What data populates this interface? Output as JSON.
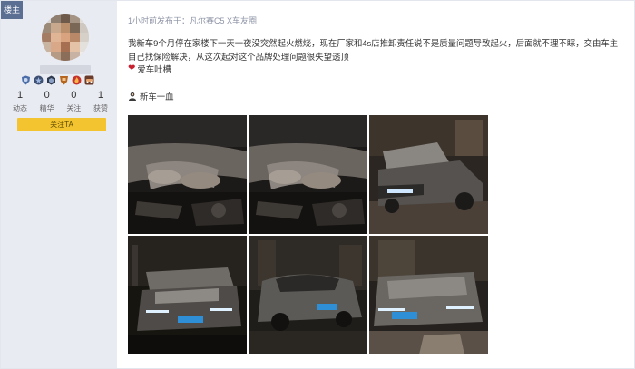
{
  "user": {
    "owner_badge": "楼主",
    "avatar_icon": "blurred-avatar-icon",
    "medals": [
      "shield-medal-icon",
      "star-medal-icon",
      "hex-medal-icon",
      "crest-medal-icon",
      "flame-medal-icon",
      "car-medal-icon"
    ],
    "stats": [
      {
        "value": "1",
        "label": "动态"
      },
      {
        "value": "0",
        "label": "精华"
      },
      {
        "value": "0",
        "label": "关注"
      },
      {
        "value": "1",
        "label": "获赞"
      }
    ],
    "follow_label": "关注TA"
  },
  "post": {
    "meta_prefix": "1小时前发布于：",
    "forum_name": "凡尔赛C5 X车友圈",
    "body": "我新车9个月停在家楼下一天一夜没突然起火燃烧，现在厂家和4s店推卸责任说不是质量问题导致起火，后面就不理不睬，交由车主自己找保险解决，从这次起对这个品牌处理问题很失望透顶",
    "tag_icon": "heart-icon",
    "tag_label": "爱车吐槽",
    "badge_icon": "user-badge-icon",
    "badge_label": "新车一血",
    "photos": [
      {
        "name": "engine-bay-photo-1"
      },
      {
        "name": "engine-bay-photo-2"
      },
      {
        "name": "car-front-hood-open-photo"
      },
      {
        "name": "car-front-plate-photo-1"
      },
      {
        "name": "car-side-night-photo"
      },
      {
        "name": "car-front-plate-photo-2"
      }
    ]
  },
  "colors": {
    "sidebar_bg": "#e9ebf3",
    "owner_badge_bg": "#5b6f93",
    "follow_button_bg": "#f4c430",
    "meta_text": "#8e94a6",
    "heart": "#c8202f"
  }
}
